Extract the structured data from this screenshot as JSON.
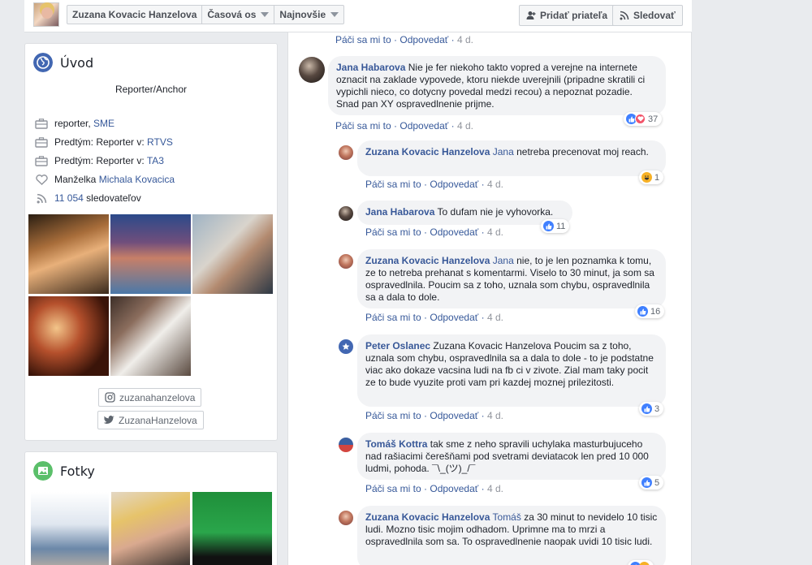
{
  "topbar": {
    "profile_name": "Zuzana Kovacic Hanzelova",
    "timeline_label": "Časová os",
    "sort_label": "Najnovšie",
    "add_friend_label": "Pridať priateľa",
    "follow_label": "Sledovať"
  },
  "intro": {
    "title": "Úvod",
    "bio": "Reporter/Anchor",
    "items": [
      {
        "prefix": "reporter, ",
        "link": "SME"
      },
      {
        "prefix": "Predtým: Reporter v: ",
        "link": "RTVS"
      },
      {
        "prefix": "Predtým: Reporter v: ",
        "link": "TA3"
      },
      {
        "prefix": "Manželka ",
        "link": "Michala Kovacica"
      },
      {
        "prefix": "",
        "link": "11 054",
        "suffix": " sledovateľov"
      }
    ],
    "instagram": "zuzanahanzelova",
    "twitter": "ZuzanaHanzelova"
  },
  "photos_card": {
    "title": "Fotky"
  },
  "comments": [
    {
      "meta_only": true,
      "like": "Páči sa mi to",
      "reply": "Odpovedať",
      "time": "4 d."
    },
    {
      "author": "Jana Habarova",
      "text": "Nie je fer niekoho takto vopred a verejne na internete oznacit na zaklade vypovede, ktoru niekde uverejnili (pripadne skratili ci vypichli nieco, co dotycny povedal medzi recou) a nepoznat pozadie. Snad pan XY ospravedlnenie prijme.",
      "like": "Páči sa mi to",
      "reply": "Odpovedať",
      "time": "4 d.",
      "reactions": "37"
    },
    {
      "author": "Zuzana Kovacic Hanzelova",
      "mention": "Jana",
      "text": " netreba precenovat moj reach.",
      "like": "Páči sa mi to",
      "reply": "Odpovedať",
      "time": "4 d.",
      "reactions": "1"
    },
    {
      "author": "Jana Habarova",
      "text": "To dufam nie je vyhovorka.",
      "like": "Páči sa mi to",
      "reply": "Odpovedať",
      "time": "4 d.",
      "reactions": "11"
    },
    {
      "author": "Zuzana Kovacic Hanzelova",
      "mention": "Jana",
      "text": " nie, to je len poznamka k tomu, ze to netreba prehanat s komentarmi. Viselo to 30 minut, ja som sa ospravedlnila. Poucim sa z toho, uznala som chybu, ospravedlnila sa a dala to dole.",
      "like": "Páči sa mi to",
      "reply": "Odpovedať",
      "time": "4 d.",
      "reactions": "16"
    },
    {
      "author": "Peter Oslanec",
      "text": "Zuzana Kovacic Hanzelova Poucim sa z toho, uznala som chybu, ospravedlnila sa a dala to dole - to je podstatne viac ako dokaze vacsina ludi na fb ci v zivote. Zial mam taky pocit ze to bude vyuzite proti vam pri kazdej moznej prilezitosti.",
      "like": "Páči sa mi to",
      "reply": "Odpovedať",
      "time": "4 d.",
      "reactions": "3"
    },
    {
      "author": "Tomáš Kottra",
      "text": "tak sme z neho spravili uchylaka masturbujuceho nad rašiacimi čerešňami pod svetrami deviatacok len pred 10 000 ludmi, pohoda. ¯\\_(ツ)_/¯",
      "like": "Páči sa mi to",
      "reply": "Odpovedať",
      "time": "4 d.",
      "reactions": "5"
    },
    {
      "author": "Zuzana Kovacic Hanzelova",
      "mention": "Tomáš",
      "text": " za 30 minut to nevidelo 10 tisic ludi. Mozno tisic mojim odhadom. Uprimne ma to mrzi a ospravedlnila som sa. To ospravedlnenie naopak uvidi 10 tisic ludi."
    }
  ],
  "colors": {
    "accent": "#365899",
    "bg": "#e9ebee",
    "bubble": "#f2f3f5"
  }
}
